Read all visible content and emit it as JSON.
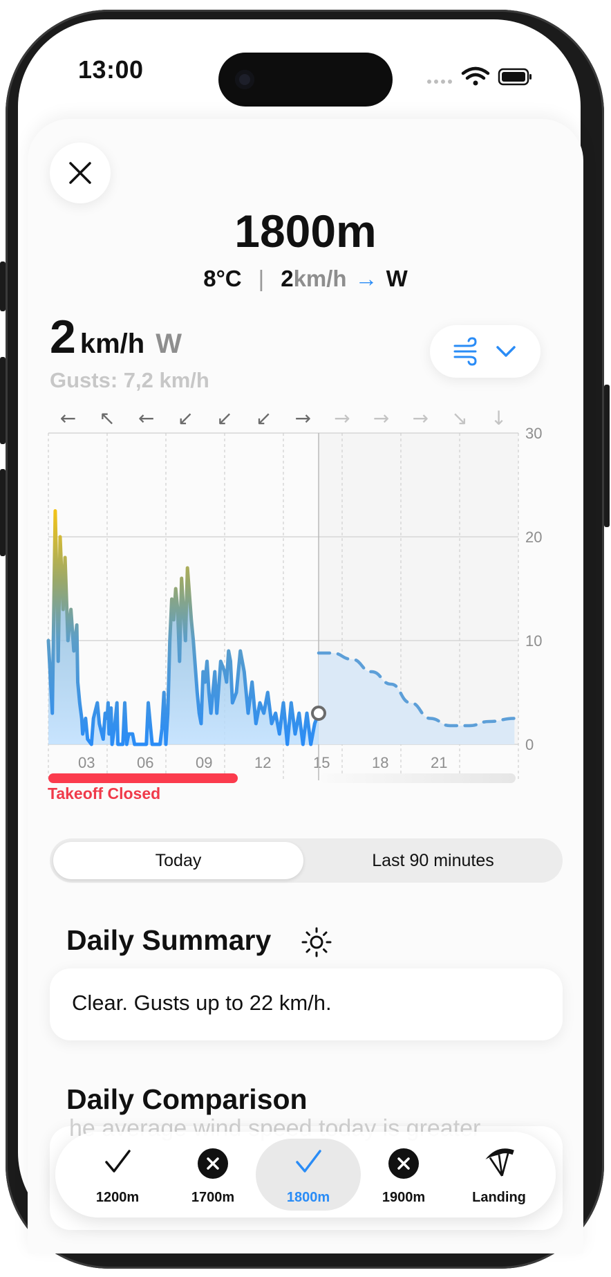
{
  "status": {
    "time": "13:00"
  },
  "header": {
    "title": "1800m",
    "temperature": "8°C",
    "separator": "|",
    "wind_value": "2",
    "wind_unit": "km/h",
    "arrow": "→",
    "direction": "W"
  },
  "current": {
    "speed": "2",
    "unit": "km/h",
    "direction": "W",
    "gusts": "Gusts: 7,2 km/h"
  },
  "chart_data": {
    "type": "line",
    "x_tick_labels": [
      "03",
      "06",
      "09",
      "12",
      "15",
      "18",
      "21"
    ],
    "y_tick_labels": [
      "30",
      "20",
      "10",
      "0"
    ],
    "ylim": [
      0,
      30
    ],
    "xlim_hours": [
      0,
      24
    ],
    "now_hour": 13.8,
    "grid": true,
    "direction_arrows": [
      "←",
      "↖",
      "←",
      "↙",
      "↙",
      "↙",
      "→",
      "→",
      "→",
      "→",
      "↘",
      "↓"
    ],
    "series": [
      {
        "style": "observed",
        "x": [
          0,
          0.2,
          0.35,
          0.45,
          0.5,
          0.6,
          0.75,
          0.85,
          1.0,
          1.15,
          1.3,
          1.45,
          1.5,
          1.6,
          1.7,
          1.75,
          1.9,
          2.0,
          2.2,
          2.3,
          2.5,
          2.6,
          2.8,
          2.9,
          3.0,
          3.05,
          3.1,
          3.2,
          3.25,
          3.4,
          3.5,
          3.55,
          3.6,
          3.75,
          3.8,
          3.9,
          4.0,
          4.1,
          4.3,
          4.4,
          4.6,
          4.8,
          5.0,
          5.1,
          5.2,
          5.3,
          5.4,
          5.5,
          5.6,
          5.7,
          5.8,
          5.9,
          6.0,
          6.1,
          6.2,
          6.3,
          6.4,
          6.5,
          6.6,
          6.7,
          6.8,
          7.0,
          7.1,
          7.3,
          7.4,
          7.6,
          7.7,
          7.8,
          7.9,
          8.0,
          8.1,
          8.2,
          8.3,
          8.4,
          8.5,
          8.6,
          8.8,
          9.0,
          9.1,
          9.2,
          9.3,
          9.4,
          9.6,
          9.8,
          10.0,
          10.2,
          10.4,
          10.6,
          10.8,
          11.0,
          11.2,
          11.4,
          11.6,
          11.8,
          12.0,
          12.2,
          12.4,
          12.6,
          12.8,
          13.0,
          13.2,
          13.4,
          13.6,
          13.8
        ],
        "values": [
          10,
          3,
          22.5,
          14,
          8,
          20,
          13,
          18,
          10,
          13,
          9,
          11.5,
          6,
          4,
          2.5,
          1,
          2.5,
          0.5,
          0,
          2.5,
          4,
          2,
          0.5,
          3,
          2.5,
          4,
          1,
          3.5,
          0,
          2,
          4,
          0,
          0,
          0,
          0,
          4,
          0,
          1,
          1,
          0,
          0,
          0,
          0,
          4,
          2,
          0,
          0,
          0,
          0,
          0,
          1.5,
          5,
          0,
          3,
          10,
          14,
          12,
          15,
          13,
          8,
          16,
          10,
          17,
          12,
          10,
          5,
          3,
          2,
          7,
          6,
          8,
          5,
          3,
          5,
          7,
          3,
          8,
          7,
          6,
          9,
          8,
          4,
          5,
          9,
          7,
          3,
          6,
          2,
          4,
          3,
          5,
          2,
          3,
          1,
          4,
          0,
          4,
          1,
          3,
          0,
          3,
          0,
          2,
          3
        ]
      },
      {
        "style": "forecast",
        "x": [
          13.8,
          14.5,
          15.5,
          16.5,
          17.5,
          18.5,
          19.5,
          20.5,
          21.5,
          22.5,
          23.8
        ],
        "values": [
          8.8,
          8.8,
          8.2,
          7.0,
          5.8,
          4.0,
          2.5,
          1.8,
          1.8,
          2.2,
          2.5
        ]
      }
    ],
    "gust_max": 22
  },
  "takeoff": {
    "label": "Takeoff Closed"
  },
  "segmented": {
    "today": "Today",
    "last90": "Last 90 minutes"
  },
  "summary": {
    "heading": "Daily Summary",
    "text": "Clear. Gusts up to 22 km/h."
  },
  "comparison": {
    "heading": "Daily Comparison",
    "ghost_text": "he average wind speed today is greater"
  },
  "tabs": [
    {
      "label": "1200m",
      "state": "check"
    },
    {
      "label": "1700m",
      "state": "closed"
    },
    {
      "label": "1800m",
      "state": "check-active"
    },
    {
      "label": "1900m",
      "state": "closed"
    },
    {
      "label": "Landing",
      "state": "landing"
    }
  ],
  "colors": {
    "accent": "#2a8cf6",
    "closed": "#f03a4a",
    "gust_peak": "#f2c318"
  }
}
